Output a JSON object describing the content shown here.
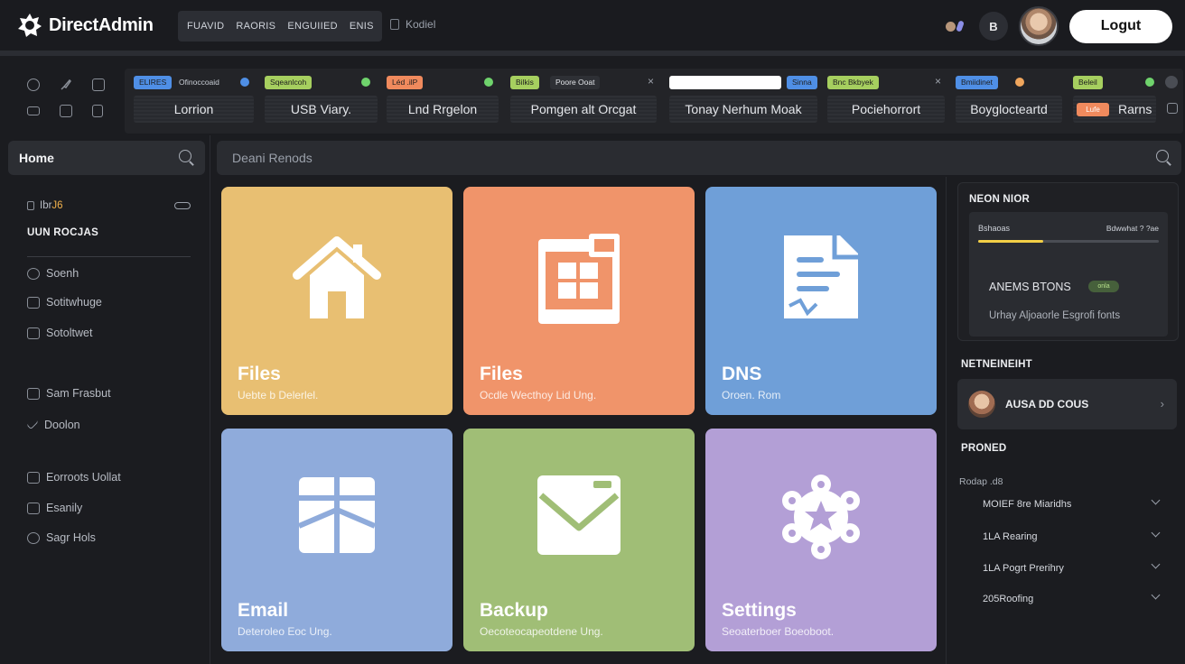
{
  "header": {
    "brand": "DirectAdmin",
    "nav": [
      "FUAVID",
      "RAORIS",
      "ENGUIIED",
      "ENIS"
    ],
    "nav_extra": "Kodiel",
    "icon_button": "B",
    "logout_label": "Logut"
  },
  "toolbar": {
    "tiles": [
      {
        "tag": "ELIRES",
        "tag2": "Ofinoccoaid",
        "label": "Lorrion",
        "tag_color": "#4f8fe6"
      },
      {
        "tag": "Sqeanlcoh",
        "label": "USB Viary.",
        "tag_color": "#a6cf5f"
      },
      {
        "tag": "Léd .ilP",
        "label": "Lnd Rrgelon",
        "tag_color": "#f08a5d"
      },
      {
        "tag": "Bilkis",
        "tag2": "Poore Ooat",
        "label": "Pomgen alt Orcgat",
        "tag_color": "#a6cf5f"
      },
      {
        "tag": "Sinna",
        "label": "Tonay Nerhum Moak",
        "tag_color": "#4f8fe6"
      },
      {
        "tag": "Bnc Bkbyek",
        "label": "Pociehorrort",
        "tag_color": "#a6cf5f"
      },
      {
        "tag": "Bmiidinet",
        "label": "Boyglocteartd",
        "tag_color": "#4f8fe6"
      },
      {
        "tag": "Beleil",
        "chip": "Lufe",
        "label": "Rarns",
        "tag_color": "#a6cf5f"
      }
    ]
  },
  "sidebar": {
    "search_label": "Home",
    "user": "Ibr",
    "user_accent": "J6",
    "section": "UUN ROCJAS",
    "items": [
      {
        "label": "Soenh",
        "icon": "globe-icon"
      },
      {
        "label": "Sotitwhuge",
        "icon": "database-icon"
      },
      {
        "label": "Sotoltwet",
        "icon": "database-icon"
      },
      {
        "label": "Sam Frasbut",
        "icon": "database-icon"
      },
      {
        "label": "Doolon",
        "icon": "check-icon"
      },
      {
        "label": "Eorroots Uollat",
        "icon": "database-icon"
      },
      {
        "label": "Esanily",
        "icon": "database-icon"
      },
      {
        "label": "Sagr Hols",
        "icon": "settings-icon"
      }
    ]
  },
  "main": {
    "search_placeholder": "Deani Renods",
    "cards": [
      {
        "title": "Files",
        "subtitle": "Uebte b Delerlel.",
        "icon": "home-icon",
        "color": "#e8bf72"
      },
      {
        "title": "Files",
        "subtitle": "Ocdle Wecthoy Lid Ung.",
        "icon": "window-icon",
        "color": "#f0946a"
      },
      {
        "title": "DNS",
        "subtitle": "Oroen. Rom",
        "icon": "document-icon",
        "color": "#6f9fd8"
      },
      {
        "title": "Email",
        "subtitle": "Deteroleo Eoc Ung.",
        "icon": "envelope-open-icon",
        "color": "#8fabdb"
      },
      {
        "title": "Backup",
        "subtitle": "Oecoteocapeotdene Ung.",
        "icon": "envelope-icon",
        "color": "#a0be76"
      },
      {
        "title": "Settings",
        "subtitle": "Seoaterboer Boeoboot.",
        "icon": "gear-icon",
        "color": "#b39fd6"
      }
    ]
  },
  "right_panel": {
    "heading": "NEON NIOR",
    "stats_left": "Bshaoas",
    "stats_right": "Bdwwhat ? ?ae",
    "progress": 0.36,
    "status_label": "ANEMS BTONS",
    "status_badge": "onla",
    "status_desc": "Urhay Aljoaorle Esgrofi fonts",
    "section2": "NETNEINEIHT",
    "account_name": "AUSA DD COUS",
    "section3": "PRONED",
    "sub_label": "Rodap .d8",
    "rows": [
      "MOIEF 8re Miaridhs",
      "1LA Rearing",
      "1LA Pogrt Prerihry",
      "205Roofing"
    ]
  }
}
